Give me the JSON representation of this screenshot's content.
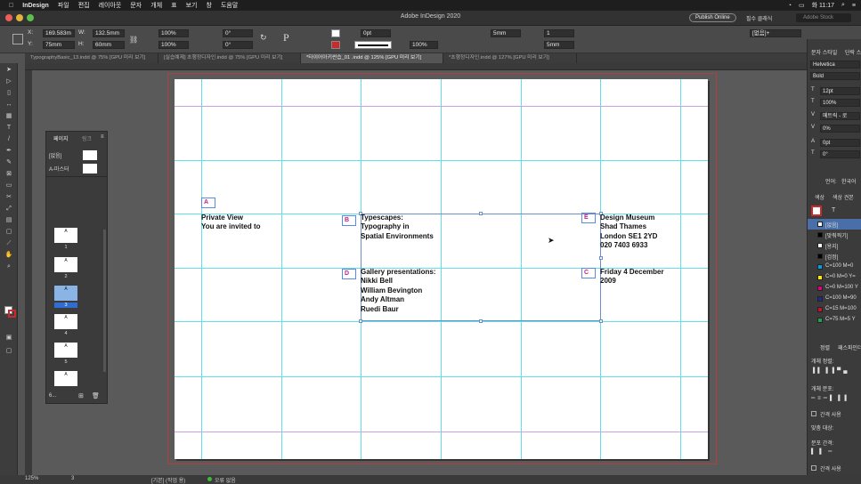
{
  "menubar": {
    "app": "InDesign",
    "items": [
      "파일",
      "편집",
      "레이아웃",
      "문자",
      "개체",
      "표",
      "보기",
      "창",
      "도움말"
    ],
    "clock": "화 11:17"
  },
  "window": {
    "title": "Adobe InDesign 2020",
    "publish_label": "Publish Online",
    "workspace": "필수 클래식",
    "search_placeholder": "Adobe Stock"
  },
  "control": {
    "x_label": "X:",
    "x_value": "169.583m",
    "y_label": "Y:",
    "y_value": "75mm",
    "w_label": "W:",
    "w_value": "132.5mm",
    "h_label": "H:",
    "h_value": "60mm",
    "scale_x": "100%",
    "scale_y": "100%",
    "angle": "0°",
    "shear": "0°",
    "stroke_weight": "0pt",
    "opacity": "100%",
    "gutter_a": "5mm",
    "cols": "1",
    "gutter_b": "5mm",
    "style": "[없음]+"
  },
  "tabs": [
    "TypographyBasic_13.indd @ 75% [GPU 미리 보기]",
    "[실습예제] 초행정디자인.indd @ 75% [GPU 미리 보기]",
    "*타이어아키썬습_01 .indd @ 125% [GPU 미리 보기]",
    "*초행정디자인.indd @ 127% [GPU 미리 보기]"
  ],
  "active_tab": 2,
  "page": {
    "labels": {
      "a": "A",
      "b": "B",
      "c": "C",
      "d": "D",
      "e": "E"
    },
    "private_view": [
      "Private View",
      "You are invited to"
    ],
    "typescapes": [
      "Typescapes:",
      "Typography in",
      "Spatial Environments"
    ],
    "gallery": [
      "Gallery presentations:",
      "Nikki Bell",
      "William Bevington",
      "Andy Altman",
      "Ruedi Baur"
    ],
    "museum": [
      "Design Museum",
      "Shad Thames",
      "London SE1 2YD",
      "020 7403 6933"
    ],
    "date": [
      "Friday 4 December",
      "2009"
    ]
  },
  "pages_panel": {
    "tab_pages": "페이지",
    "tab_links": "링크",
    "none": "[없음]",
    "master": "A-마스터",
    "thumbs": [
      {
        "letter": "A",
        "num": "1"
      },
      {
        "letter": "A",
        "num": "2"
      },
      {
        "letter": "A",
        "num": "3"
      },
      {
        "letter": "A",
        "num": "4"
      },
      {
        "letter": "A",
        "num": "5"
      },
      {
        "letter": "A",
        "num": "6"
      }
    ],
    "footer": "6..."
  },
  "right_panel": {
    "tab1": "문자 스타일",
    "tab2": "단락 스",
    "font": "Helvetica",
    "style": "Bold",
    "size": "12pt",
    "leading": "100%",
    "kerning": "메트릭 - 로",
    "tracking": "0%",
    "baseline": "0pt",
    "skew": "0°",
    "language_label": "언어:",
    "language": "한국어",
    "swatch_tab1": "색상",
    "swatch_tab2": "색상 견본",
    "swatches": [
      {
        "name": "[없음]",
        "color": "#ffffff"
      },
      {
        "name": "[맞춰찍기]",
        "color": "#000000"
      },
      {
        "name": "[용지]",
        "color": "#ffffff"
      },
      {
        "name": "[검정]",
        "color": "#000000"
      },
      {
        "name": "C=100 M=0",
        "color": "#00a0e6"
      },
      {
        "name": "C=0 M=0 Y=",
        "color": "#ffe600"
      },
      {
        "name": "C=0 M=100 Y",
        "color": "#e0007a"
      },
      {
        "name": "C=100 M=90",
        "color": "#1e2b8c"
      },
      {
        "name": "C=15 M=100",
        "color": "#c4122f"
      },
      {
        "name": "C=75 M=5 Y",
        "color": "#20a050"
      }
    ],
    "align_tab1": "정렬",
    "align_tab2": "패스파인더",
    "align_objects": "개체 정렬:",
    "distribute_objects": "개체 분포:",
    "use_spacing1": "간격 사용",
    "align_to": "맞춤 대상:",
    "distribute_spacing": "분포 간격:",
    "use_spacing2": "간격 사용"
  },
  "status": {
    "zoom": "125%",
    "page": "3",
    "preflight": "[기본] (작업 용)",
    "errors": "오류 없음"
  }
}
